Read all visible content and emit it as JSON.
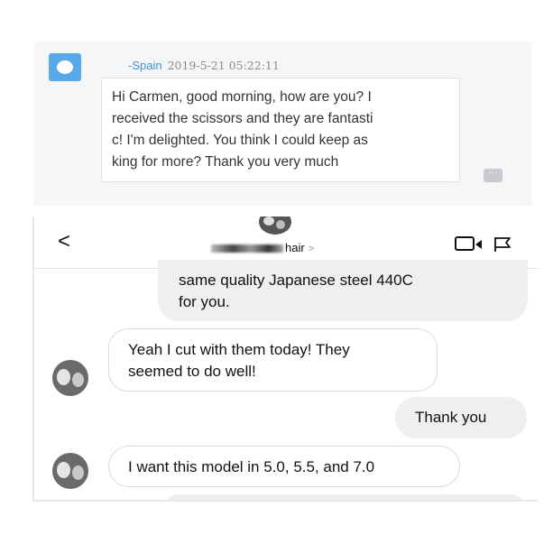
{
  "email": {
    "sender": "-Spain",
    "timestamp": "2019-5-21 05:22:11",
    "message_lines": [
      "Hi Carmen, good morning, how are you? I",
      "received the scissors and they are fantasti",
      "c! I'm delighted. You think I could keep as",
      "king for more? Thank you very much"
    ],
    "more_label": "···"
  },
  "chat": {
    "back_label": "<",
    "header_title": "hair",
    "header_chevron": ">",
    "messages": [
      {
        "from": "me",
        "lines": [
          "same quality Japanese steel 440C",
          "for you."
        ]
      },
      {
        "from": "them",
        "lines": [
          "Yeah I cut with them today! They",
          "seemed to do well!"
        ]
      },
      {
        "from": "me",
        "lines": [
          "Thank you"
        ]
      },
      {
        "from": "them",
        "lines": [
          "I want this model in 5.0, 5.5, and 7.0"
        ]
      }
    ]
  },
  "colors": {
    "sender_name": "#3e8fd4",
    "avatar_bg": "#5aa8e6",
    "outgoing_bubble": "#efefef"
  },
  "icons": [
    "cloud-icon",
    "back-icon",
    "video-call-icon",
    "flag-icon",
    "more-icon"
  ]
}
